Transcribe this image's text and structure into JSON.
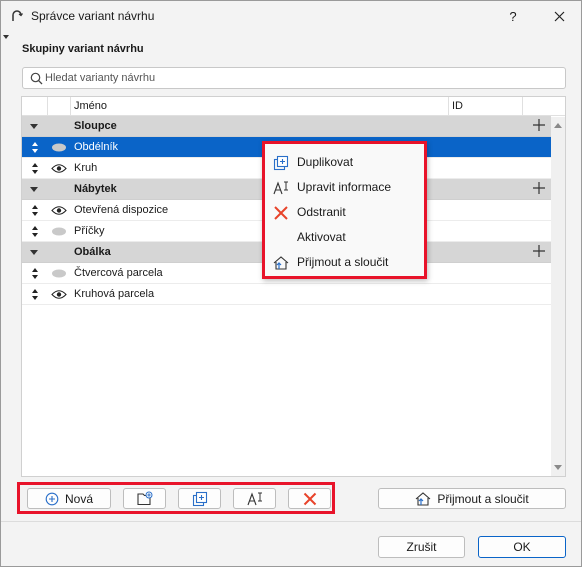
{
  "window": {
    "title": "Správce variant návrhu",
    "help_label": "?"
  },
  "section_label": "Skupiny variant návrhu",
  "search": {
    "placeholder": "Hledat varianty návrhu",
    "value": ""
  },
  "table": {
    "columns": [
      "Jméno",
      "ID"
    ],
    "rows": [
      {
        "kind": "group",
        "label": "Sloupce"
      },
      {
        "kind": "item",
        "label": "Obdélník",
        "visibility": "hidden",
        "selected": true
      },
      {
        "kind": "item",
        "label": "Kruh",
        "visibility": "visible",
        "selected": false
      },
      {
        "kind": "group",
        "label": "Nábytek"
      },
      {
        "kind": "item",
        "label": "Otevřená dispozice",
        "visibility": "visible",
        "selected": false
      },
      {
        "kind": "item",
        "label": "Příčky",
        "visibility": "hidden",
        "selected": false
      },
      {
        "kind": "group",
        "label": "Obálka"
      },
      {
        "kind": "item",
        "label": "Čtvercová parcela",
        "visibility": "hidden",
        "selected": false
      },
      {
        "kind": "item",
        "label": "Kruhová parcela",
        "visibility": "visible",
        "selected": false
      }
    ]
  },
  "context_menu": {
    "items": [
      {
        "label": "Duplikovat",
        "icon": "duplicate-icon"
      },
      {
        "label": "Upravit informace",
        "icon": "rename-icon"
      },
      {
        "label": "Odstranit",
        "icon": "delete-icon"
      },
      {
        "label": "Aktivovat",
        "icon": ""
      },
      {
        "label": "Přijmout a sloučit",
        "icon": "merge-icon"
      }
    ]
  },
  "toolbar": {
    "new_label": "Nová",
    "merge_label": "Přijmout a sloučit"
  },
  "footer": {
    "cancel_label": "Zrušit",
    "ok_label": "OK"
  },
  "colors": {
    "selection": "#0a64c8",
    "highlight_outline": "#e8132a",
    "delete_icon": "#e8432a",
    "group_row": "#d6d6d6"
  }
}
